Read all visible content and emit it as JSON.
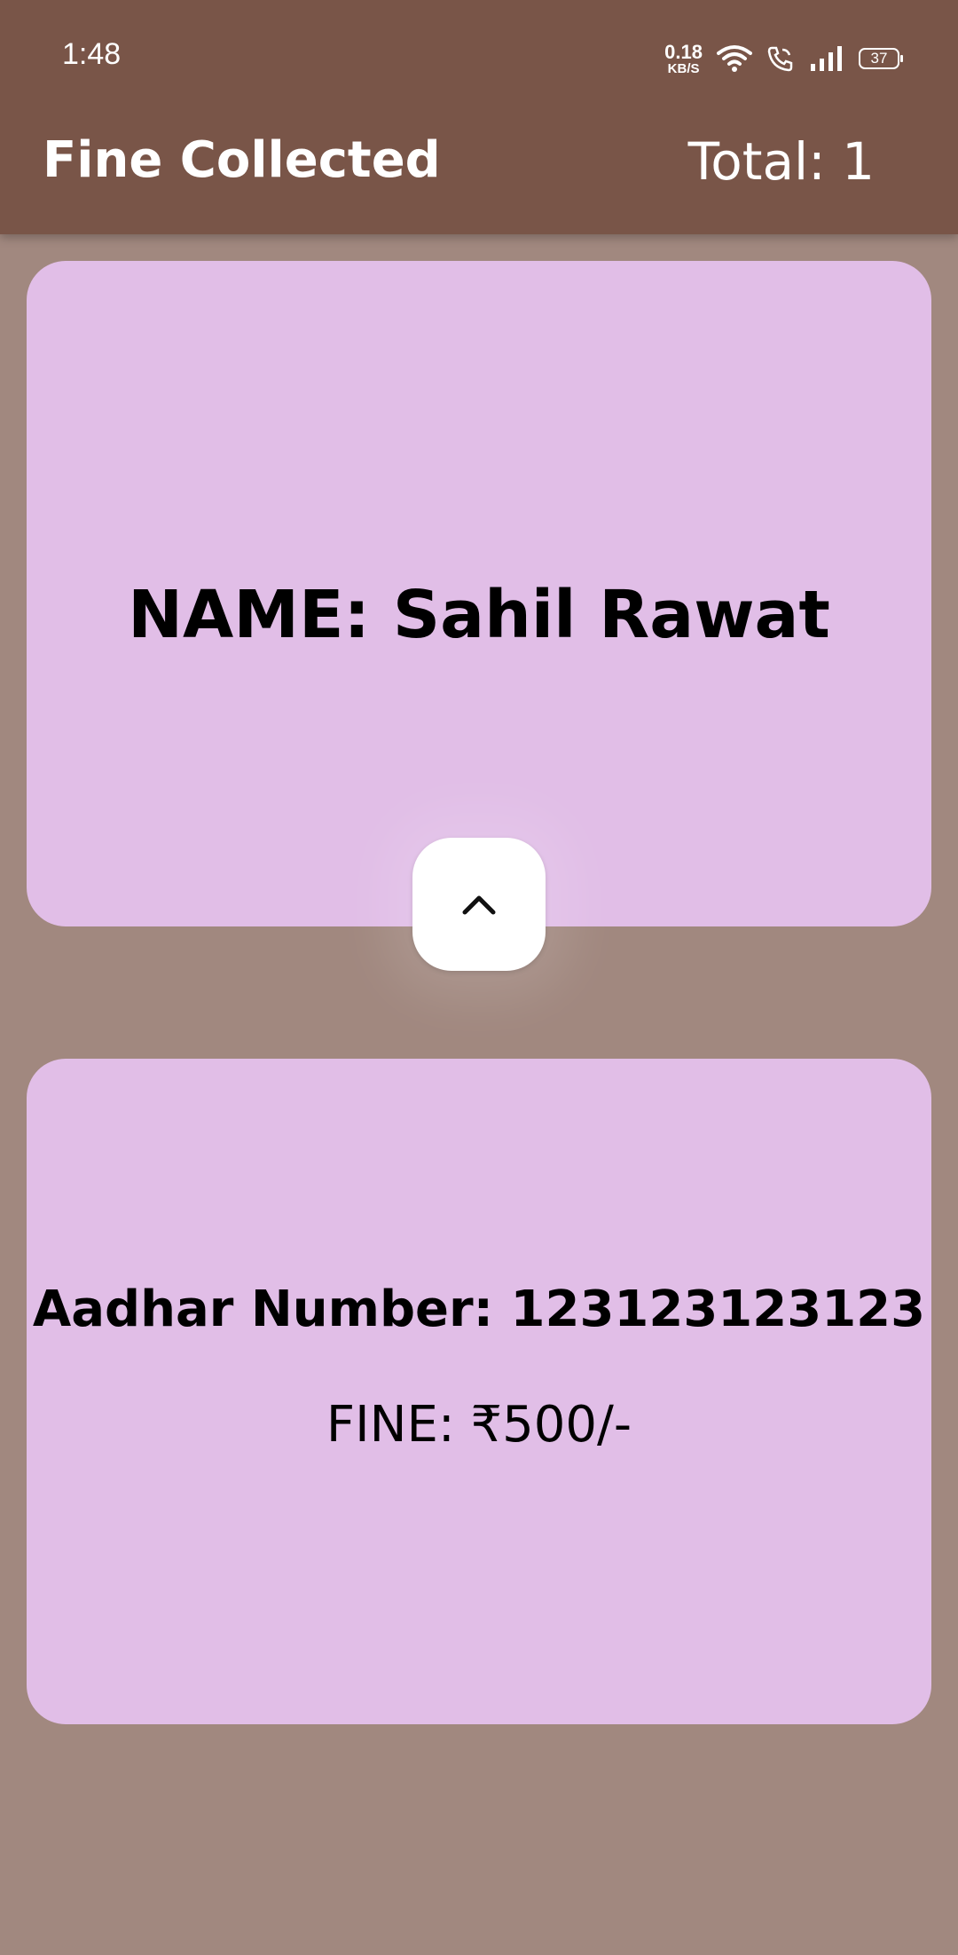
{
  "status_bar": {
    "time": "1:48",
    "speed_value": "0.18",
    "speed_unit": "KB/S",
    "battery": "37",
    "icons": [
      "wifi-icon",
      "wifi-call-icon",
      "signal-icon",
      "battery-icon"
    ]
  },
  "app_bar": {
    "title": "Fine Collected",
    "total": "Total: 1",
    "background": "#795548"
  },
  "record": {
    "name": "NAME: Sahil Rawat",
    "aadhar": "Aadhar Number: 123123123123",
    "fine": "FINE: ₹500/-"
  },
  "toggle": {
    "icon": "chevron-up-icon"
  },
  "colors": {
    "page_background": "#a1887f",
    "card_background": "#e1bee7",
    "button_background": "#ffffff"
  }
}
